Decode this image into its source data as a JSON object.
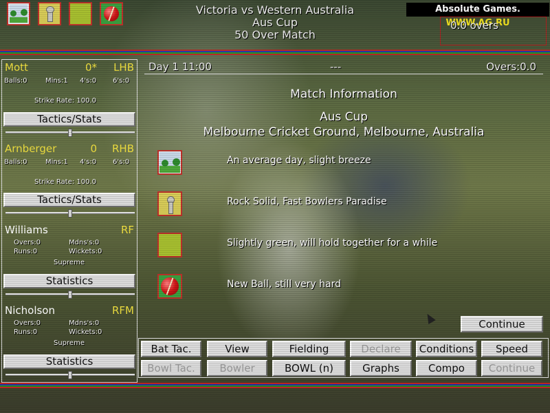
{
  "header": {
    "match": "Victoria vs Western Australia",
    "competition": "Aus Cup",
    "format": "50 Over Match",
    "watermark_prefix": "Absolute Games.",
    "watermark_url": "WWW.AG.RU",
    "overs_display": "0.0 overs"
  },
  "top_icons": [
    "weather-icon",
    "pitch-key-icon",
    "grass-icon",
    "cricket-ball-icon"
  ],
  "status": {
    "day_time": "Day 1 11:00",
    "dashes": "---",
    "overs": "Overs:0.0"
  },
  "batsmen": [
    {
      "name": "Mott",
      "score": "0*",
      "hand": "LHB",
      "balls": "Balls:0",
      "mins": "Mins:1",
      "fours": "4's:0",
      "sixes": "6's:0",
      "strike_rate": "Strike Rate: 100.0",
      "button": "Tactics/Stats",
      "slider_level": 0.5
    },
    {
      "name": "Arnberger",
      "score": "0",
      "hand": "RHB",
      "balls": "Balls:0",
      "mins": "Mins:1",
      "fours": "4's:0",
      "sixes": "6's:0",
      "strike_rate": "Strike Rate: 100.0",
      "button": "Tactics/Stats",
      "slider_level": 0.5
    }
  ],
  "bowlers": [
    {
      "name": "Williams",
      "type": "RF",
      "overs": "Overs:0",
      "maidens": "Mdns's:0",
      "runs": "Runs:0",
      "wickets": "Wickets:0",
      "form": "Supreme",
      "button": "Statistics",
      "slider_level": 0.5
    },
    {
      "name": "Nicholson",
      "type": "RFM",
      "overs": "Overs:0",
      "maidens": "Mdns's:0",
      "runs": "Runs:0",
      "wickets": "Wickets:0",
      "form": "Supreme",
      "button": "Statistics",
      "slider_level": 0.5
    }
  ],
  "match_info": {
    "title": "Match Information",
    "competition": "Aus Cup",
    "venue": "Melbourne Cricket Ground, Melbourne, Australia",
    "conditions": [
      {
        "icon": "weather-icon",
        "text": "An average day, slight breeze"
      },
      {
        "icon": "pitch-key-icon",
        "text": "Rock Solid, Fast Bowlers Paradise"
      },
      {
        "icon": "grass-icon",
        "text": "Slightly green, will hold together for a while"
      },
      {
        "icon": "cricket-ball-icon",
        "text": "New Ball, still very hard"
      }
    ],
    "continue": "Continue"
  },
  "toolbar": {
    "row1": [
      "Bat Tac.",
      "View",
      "Fielding",
      "Declare",
      "Conditions",
      "Speed"
    ],
    "row2": [
      "Bowl Tac.",
      "Bowler",
      "BOWL (n)",
      "Graphs",
      "Compo",
      "Continue"
    ],
    "disabled": [
      "Declare",
      "Bowl Tac.",
      "Bowler",
      "Continue"
    ]
  }
}
